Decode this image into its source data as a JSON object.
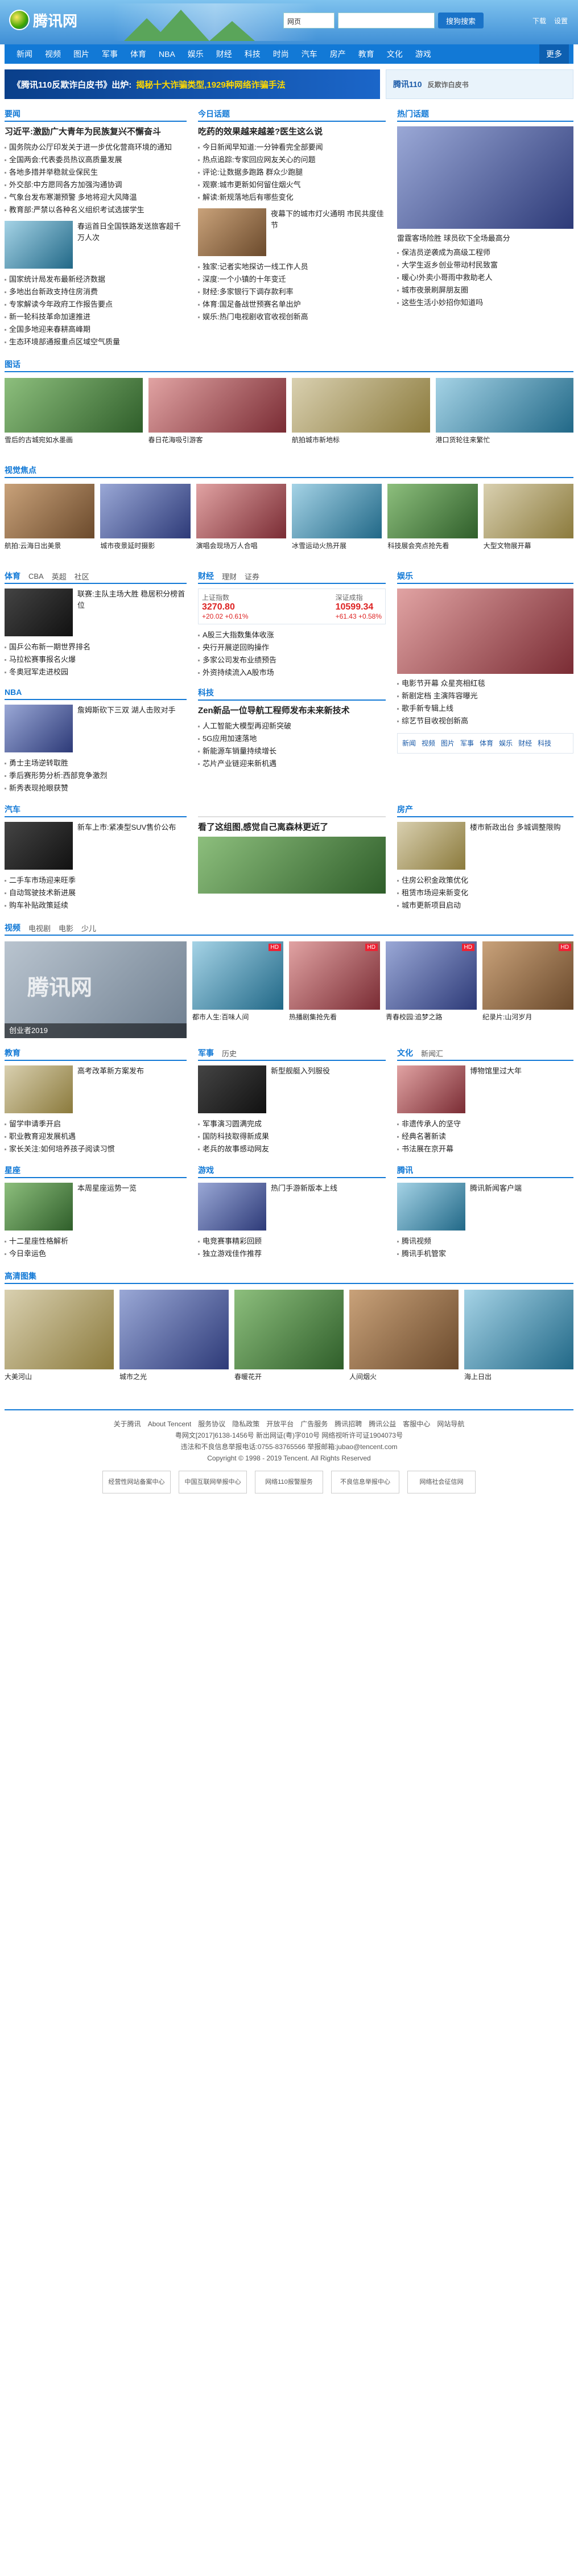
{
  "header": {
    "logo_text": "腾讯网",
    "search_select": "网页",
    "search_placeholder": "",
    "search_button": "搜狗搜索",
    "top_links": [
      "下载",
      "设置"
    ]
  },
  "nav": [
    "新闻",
    "视频",
    "图片",
    "军事",
    "体育",
    "NBA",
    "娱乐",
    "财经",
    "科技",
    "时尚",
    "汽车",
    "房产",
    "教育",
    "文化",
    "游戏",
    "更多"
  ],
  "banner": {
    "ad_title": "《腾讯110反欺诈白皮书》出炉:",
    "ad_highlight": "揭秘十大诈骗类型,1929种网络诈骗手法",
    "ad2_title": "腾讯110",
    "ad2_text": "反欺诈白皮书"
  },
  "sections": {
    "news": {
      "title": "要闻",
      "headline": "习近平:激励广大青年为民族复兴不懈奋斗",
      "items": [
        "国务院办公厅印发关于进一步优化营商环境的通知",
        "全国两会:代表委员热议高质量发展",
        "各地多措并举稳就业保民生",
        "外交部:中方愿同各方加强沟通协调",
        "气象台发布寒潮预警 多地将迎大风降温",
        "教育部:严禁以各种名义组织考试选拔学生"
      ],
      "pic_caption": "春运首日全国铁路发送旅客超千万人次",
      "items2": [
        "国家统计局发布最新经济数据",
        "多地出台新政支持住房消费",
        "专家解读今年政府工作报告要点",
        "新一轮科技革命加速推进",
        "全国多地迎来春耕高峰期",
        "生态环境部通报重点区域空气质量"
      ]
    },
    "today": {
      "title": "今日话题",
      "headline": "吃药的效果越来越差?医生这么说",
      "items": [
        "今日新闻早知道:一分钟看完全部要闻",
        "热点追踪:专家回应网友关心的问题",
        "评论:让数据多跑路 群众少跑腿",
        "观察:城市更新如何留住烟火气",
        "解读:新规落地后有哪些变化"
      ],
      "pic_caption": "夜幕下的城市灯火通明 市民共度佳节",
      "items2": [
        "独家:记者实地探访一线工作人员",
        "深度:一个小镇的十年变迁",
        "财经:多家银行下调存款利率",
        "体育:国足备战世预赛名单出炉",
        "娱乐:热门电视剧收官收视创新高"
      ]
    },
    "hot": {
      "title": "热门话题",
      "pic_caption": "雷霆客场险胜 球员砍下全场最高分",
      "items": [
        "保洁员逆袭成为高级工程师",
        "大学生返乡创业带动村民致富",
        "暖心!外卖小哥雨中救助老人",
        "城市夜景刷屏朋友圈",
        "这些生活小妙招你知道吗"
      ]
    },
    "photo": {
      "title": "图话",
      "captions": [
        "雪后的古城宛如水墨画",
        "春日花海吸引游客",
        "航拍城市新地标",
        "港口货轮往来繁忙"
      ]
    },
    "video_hot": {
      "title": "视觉焦点",
      "captions": [
        "航拍:云海日出美景",
        "城市夜景延时摄影",
        "演唱会现场万人合唱",
        "冰雪运动火热开展",
        "科技展会亮点抢先看",
        "大型文物展开幕"
      ]
    },
    "finance": {
      "title": "财经",
      "tabs": [
        "理财",
        "证券"
      ],
      "index_name": "上证指数",
      "index_value": "3270.80",
      "index_change": "+20.02 +0.61%",
      "index2_name": "深证成指",
      "index2_value": "10599.34",
      "index2_change": "+61.43 +0.58%",
      "items": [
        "A股三大指数集体收涨",
        "央行开展逆回购操作",
        "多家公司发布业绩预告",
        "外资持续流入A股市场"
      ]
    },
    "sports": {
      "title": "体育",
      "tabs": [
        "CBA",
        "英超",
        "社区"
      ],
      "items": [
        "联赛:主队主场大胜 稳居积分榜首位",
        "国乒公布新一期世界排名",
        "马拉松赛事报名火爆",
        "冬奥冠军走进校园"
      ]
    },
    "nba": {
      "title": "NBA",
      "items": [
        "詹姆斯砍下三双 湖人击败对手",
        "勇士主场逆转取胜",
        "季后赛形势分析:西部竞争激烈",
        "新秀表现抢眼获赞"
      ]
    },
    "ent": {
      "title": "娱乐",
      "items": [
        "电影节开幕 众星亮相红毯",
        "新剧定档 主演阵容曝光",
        "歌手新专辑上线",
        "综艺节目收视创新高"
      ]
    },
    "tech": {
      "title": "科技",
      "headline": "Zen新品一位导航工程师发布未来新技术",
      "items": [
        "人工智能大模型再迎新突破",
        "5G应用加速落地",
        "新能源车销量持续增长",
        "芯片产业链迎来新机遇"
      ]
    },
    "auto": {
      "title": "汽车",
      "headline": "看了这组图,感觉自己离森林更近了",
      "items": [
        "新车上市:紧凑型SUV售价公布",
        "二手车市场迎来旺季",
        "自动驾驶技术新进展",
        "购车补贴政策延续"
      ]
    },
    "house": {
      "title": "房产",
      "items": [
        "楼市新政出台 多城调整限购",
        "住房公积金政策优化",
        "租赁市场迎来新变化",
        "城市更新项目启动"
      ]
    },
    "video": {
      "title": "视频",
      "tabs": [
        "电视剧",
        "电影",
        "少儿"
      ],
      "big_caption": "创业者2019",
      "thumbs": [
        "都市人生:百味人间",
        "热播剧集抢先看",
        "青春校园:追梦之路",
        "纪录片:山河岁月"
      ]
    },
    "edu": {
      "title": "教育",
      "items": [
        "高考改革新方案发布",
        "留学申请季开启",
        "职业教育迎发展机遇",
        "家长关注:如何培养孩子阅读习惯"
      ]
    },
    "military": {
      "title": "军事",
      "tabs": [
        "历史"
      ],
      "items": [
        "新型舰艇入列服役",
        "军事演习圆满完成",
        "国防科技取得新成果",
        "老兵的故事感动网友"
      ]
    },
    "culture": {
      "title": "文化",
      "tabs": [
        "新闻汇"
      ],
      "items": [
        "博物馆里过大年",
        "非遗传承人的坚守",
        "经典名著新读",
        "书法展在京开幕"
      ]
    },
    "star": {
      "title": "星座",
      "items": [
        "本周星座运势一览",
        "十二星座性格解析",
        "今日幸运色"
      ]
    },
    "games": {
      "title": "游戏",
      "items": [
        "热门手游新版本上线",
        "电竞赛事精彩回顾",
        "独立游戏佳作推荐"
      ]
    },
    "app": {
      "title": "腾讯",
      "items": [
        "腾讯新闻客户端",
        "腾讯视频",
        "腾讯手机管家"
      ]
    },
    "hd": {
      "title": "高清图集",
      "captions": [
        "大美河山",
        "城市之光",
        "春暖花开",
        "人间烟火",
        "海上日出"
      ]
    }
  },
  "footer": {
    "links": [
      "关于腾讯",
      "About Tencent",
      "服务协议",
      "隐私政策",
      "开放平台",
      "广告服务",
      "腾讯招聘",
      "腾讯公益",
      "客服中心",
      "网站导航"
    ],
    "lines": [
      "粤网文[2017]6138-1456号 新出网证(粤)字010号 网络视听许可证1904073号",
      "违法和不良信息举报电话:0755-83765566 举报邮箱:jubao@tencent.com",
      "Copyright © 1998 - 2019 Tencent. All Rights Reserved"
    ],
    "badges": [
      "经营性网站备案中心",
      "中国互联网举报中心",
      "网络110报警服务",
      "不良信息举报中心",
      "网络社会征信网"
    ]
  }
}
